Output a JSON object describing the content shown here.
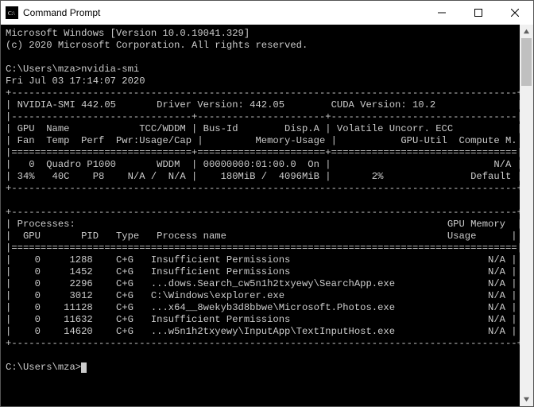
{
  "window": {
    "title": "Command Prompt"
  },
  "header": {
    "line1": "Microsoft Windows [Version 10.0.19041.329]",
    "line2": "(c) 2020 Microsoft Corporation. All rights reserved."
  },
  "prompt": {
    "path": "C:\\Users\\mza>",
    "command": "nvidia-smi",
    "timestamp": "Fri Jul 03 17:14:07 2020"
  },
  "smi": {
    "version_label": "NVIDIA-SMI 442.05",
    "driver_label": "Driver Version: 442.05",
    "cuda_label": "CUDA Version: 10.2",
    "hdr": {
      "r1c1": "GPU  Name            TCC/WDDM",
      "r1c2": "Bus-Id        Disp.A",
      "r1c3": "Volatile Uncorr. ECC",
      "r2c1": "Fan  Temp  Perf  Pwr:Usage/Cap",
      "r2c2": "Memory-Usage",
      "r2c3": "GPU-Util  Compute M."
    },
    "gpu": {
      "r1c1": "0  Quadro P1000       WDDM ",
      "r1c2": "00000000:01:00.0  On",
      "r1c3": "N/A",
      "r2c1": "34%   40C    P8    N/A /  N/A",
      "r2c2": "180MiB /  4096MiB",
      "r2c3_util": "2%",
      "r2c3_mode": "Default"
    },
    "proc_hdr": {
      "title": "Processes:",
      "mem": "GPU Memory",
      "cols": "GPU       PID   Type   Process name",
      "usage": "Usage"
    },
    "processes": [
      {
        "gpu": "0",
        "pid": "1288",
        "type": "C+G",
        "name": "Insufficient Permissions",
        "mem": "N/A"
      },
      {
        "gpu": "0",
        "pid": "1452",
        "type": "C+G",
        "name": "Insufficient Permissions",
        "mem": "N/A"
      },
      {
        "gpu": "0",
        "pid": "2296",
        "type": "C+G",
        "name": "...dows.Search_cw5n1h2txyewy\\SearchApp.exe",
        "mem": "N/A"
      },
      {
        "gpu": "0",
        "pid": "3012",
        "type": "C+G",
        "name": "C:\\Windows\\explorer.exe",
        "mem": "N/A"
      },
      {
        "gpu": "0",
        "pid": "11128",
        "type": "C+G",
        "name": "...x64__8wekyb3d8bbwe\\Microsoft.Photos.exe",
        "mem": "N/A"
      },
      {
        "gpu": "0",
        "pid": "11632",
        "type": "C+G",
        "name": "Insufficient Permissions",
        "mem": "N/A"
      },
      {
        "gpu": "0",
        "pid": "14620",
        "type": "C+G",
        "name": "...w5n1h2txyewy\\InputApp\\TextInputHost.exe",
        "mem": "N/A"
      }
    ]
  }
}
